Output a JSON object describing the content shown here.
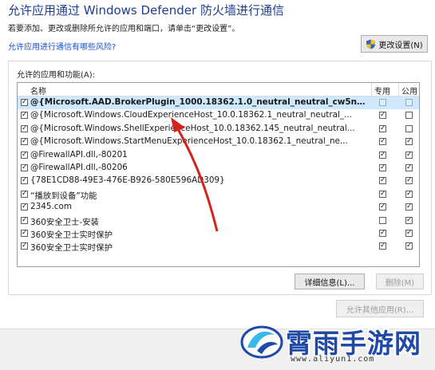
{
  "title": "允许应用通过 Windows Defender 防火墙进行通信",
  "description": "若要添加、更改或删除所允许的应用和端口，请单击“更改设置”。",
  "risk_link": "允许应用进行通信有哪些风险?",
  "change_settings_label": "更改设置(N)",
  "group_label": "允许的应用和功能(A):",
  "columns": {
    "name": "名称",
    "private": "专用",
    "public": "公用"
  },
  "rows": [
    {
      "name": "@{Microsoft.AAD.BrokerPlugin_1000.18362.1.0_neutral_neutral_cw5n1h2tx...",
      "checked": true,
      "private": false,
      "public": false,
      "selected": true
    },
    {
      "name": "@{Microsoft.Windows.CloudExperienceHost_10.0.18362.1_neutral_neutral_...",
      "checked": true,
      "private": true,
      "public": false
    },
    {
      "name": "@{Microsoft.Windows.ShellExperienceHost_10.0.18362.145_neutral_neutral...",
      "checked": true,
      "private": true,
      "public": false
    },
    {
      "name": "@{Microsoft.Windows.StartMenuExperienceHost_10.0.18362.1_neutral_ne...",
      "checked": true,
      "private": true,
      "public": true
    },
    {
      "name": "@FirewallAPI.dll,-80201",
      "checked": true,
      "private": true,
      "public": true
    },
    {
      "name": "@FirewallAPI.dll,-80206",
      "checked": true,
      "private": true,
      "public": true
    },
    {
      "name": "{78E1CD88-49E3-476E-B926-580E596AD309}",
      "checked": true,
      "private": true,
      "public": true
    },
    {
      "name": "“播放到设备”功能",
      "checked": true,
      "private": true,
      "public": true
    },
    {
      "name": "2345.com",
      "checked": true,
      "private": true,
      "public": true
    },
    {
      "name": "360安全卫士-安装",
      "checked": true,
      "private": false,
      "public": true
    },
    {
      "name": "360安全卫士实时保护",
      "checked": true,
      "private": true,
      "public": true
    },
    {
      "name": "360安全卫士实时保护",
      "checked": true,
      "private": true,
      "public": true
    }
  ],
  "details_label": "详细信息(L)...",
  "remove_label": "删除(M)",
  "allow_other_label": "允许其他应用(R)...",
  "watermark": {
    "text": "霄雨手游网",
    "url": "www.aliyun1.com"
  },
  "colors": {
    "title": "#1e3f8f",
    "link": "#1a52c8",
    "selection": "#cde8ff",
    "arrow": "#d3241c"
  }
}
